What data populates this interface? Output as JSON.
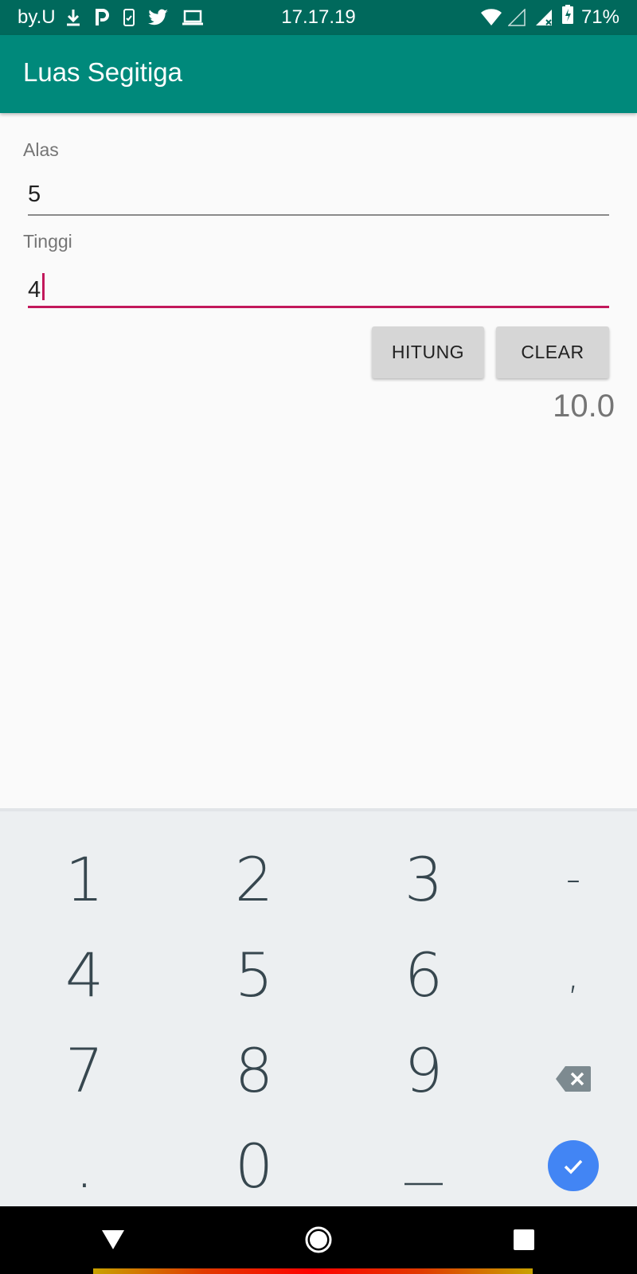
{
  "status_bar": {
    "carrier": "by.U",
    "time": "17.17.19",
    "battery": "71%",
    "icons": [
      "download-icon",
      "parking-app-icon",
      "sim-icon",
      "twitter-icon",
      "laptop-icon",
      "wifi-icon",
      "signal-icon",
      "battery-charging-icon"
    ]
  },
  "app_bar": {
    "title": "Luas Segitiga"
  },
  "form": {
    "alas": {
      "label": "Alas",
      "value": "5"
    },
    "tinggi": {
      "label": "Tinggi",
      "value": "4"
    },
    "buttons": {
      "hitung": "HITUNG",
      "clear": "CLEAR"
    },
    "result": "10.0"
  },
  "keyboard": {
    "keys": [
      "1",
      "2",
      "3",
      "-",
      "4",
      "5",
      "6",
      ",",
      "7",
      "8",
      "9",
      "backspace",
      ".",
      "0",
      "_",
      "done"
    ]
  },
  "colors": {
    "status_bar": "#00695c",
    "app_bar": "#00897b",
    "accent": "#c2185b",
    "done_key": "#4285f4"
  }
}
